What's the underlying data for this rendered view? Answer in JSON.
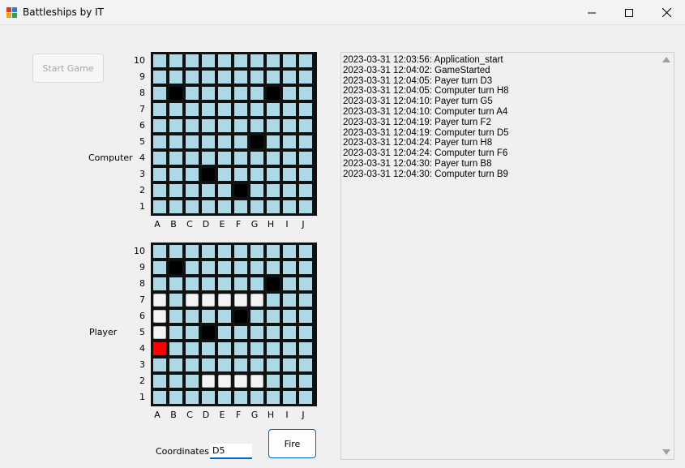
{
  "window": {
    "title": "Battleships by IT",
    "icon": "app-icon",
    "controls": [
      "minimize-icon",
      "maximize-icon",
      "close-icon"
    ]
  },
  "controls": {
    "start_game_label": "Start Game",
    "start_game_enabled": false,
    "coordinates_label": "Coordinates",
    "coordinates_value": "D5",
    "fire_label": "Fire"
  },
  "labels": {
    "computer": "Computer",
    "player": "Player"
  },
  "grid": {
    "columns": [
      "A",
      "B",
      "C",
      "D",
      "E",
      "F",
      "G",
      "H",
      "I",
      "J"
    ],
    "rows": [
      "10",
      "9",
      "8",
      "7",
      "6",
      "5",
      "4",
      "3",
      "2",
      "1"
    ]
  },
  "computer_board": {
    "ships": [
      "B8",
      "H8",
      "G5",
      "D3",
      "F2"
    ],
    "misses": [],
    "hits": []
  },
  "player_board": {
    "ships": [
      "B9",
      "H8",
      "F6",
      "D5"
    ],
    "misses": [
      "A7",
      "A6",
      "A5",
      "C7",
      "D7",
      "E7",
      "F7",
      "G7",
      "D2",
      "E2",
      "F2",
      "G2"
    ],
    "hits": [
      "A4"
    ]
  },
  "colors": {
    "water": "#add8e6",
    "ship": "#000000",
    "miss": "#f3f3f3",
    "hit": "#ff0000",
    "accent": "#0067c0"
  },
  "log": [
    "2023-03-31 12:03:56: Application_start",
    "2023-03-31 12:04:02: GameStarted",
    "2023-03-31 12:04:05: Payer turn D3",
    "2023-03-31 12:04:05: Computer turn H8",
    "2023-03-31 12:04:10: Payer turn G5",
    "2023-03-31 12:04:10: Computer turn A4",
    "2023-03-31 12:04:19: Payer turn F2",
    "2023-03-31 12:04:19: Computer turn D5",
    "2023-03-31 12:04:24: Payer turn H8",
    "2023-03-31 12:04:24: Computer turn F6",
    "2023-03-31 12:04:30: Payer turn B8",
    "2023-03-31 12:04:30: Computer turn B9"
  ]
}
